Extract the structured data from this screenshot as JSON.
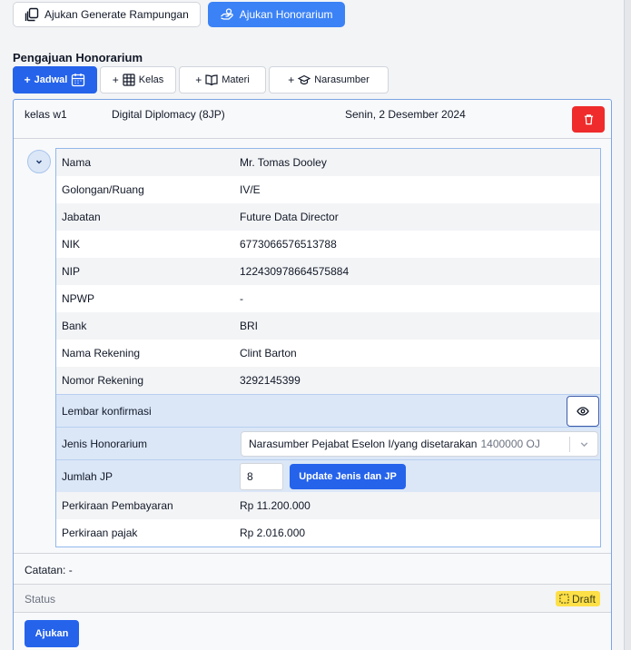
{
  "top_actions": {
    "generate_label": "Ajukan Generate Rampungan",
    "honorarium_label": "Ajukan Honorarium"
  },
  "section_title": "Pengajuan Honorarium",
  "add_buttons": {
    "jadwal": "Jadwal",
    "kelas": "Kelas",
    "materi": "Materi",
    "narasumber": "Narasumber",
    "plus": "+"
  },
  "card": {
    "kelas": "kelas w1",
    "materi": "Digital Diplomacy  (8JP)",
    "tanggal": "Senin, 2 Desember 2024"
  },
  "details": [
    {
      "label": "Nama",
      "value": "Mr. Tomas Dooley"
    },
    {
      "label": "Golongan/Ruang",
      "value": "IV/E"
    },
    {
      "label": "Jabatan",
      "value": "Future Data Director"
    },
    {
      "label": "NIK",
      "value": "6773066576513788"
    },
    {
      "label": "NIP",
      "value": "122430978664575884"
    },
    {
      "label": "NPWP",
      "value": "-"
    },
    {
      "label": "Bank",
      "value": "BRI"
    },
    {
      "label": "Nama Rekening",
      "value": "Clint Barton"
    },
    {
      "label": "Nomor Rekening",
      "value": "3292145399"
    }
  ],
  "lembar_konfirmasi": "Lembar konfirmasi",
  "jenis_honorarium": {
    "label": "Jenis Honorarium",
    "selected": "Narasumber Pejabat Eselon I/yang disetarakan",
    "amount": "1400000 OJ"
  },
  "jumlah_jp": {
    "label": "Jumlah JP",
    "value": "8",
    "update_label": "Update Jenis dan JP"
  },
  "perkiraan_pembayaran": {
    "label": "Perkiraan Pembayaran",
    "value": "Rp 11.200.000"
  },
  "perkiraan_pajak": {
    "label": "Perkiraan pajak",
    "value": "Rp 2.016.000"
  },
  "catatan": "Catatan: -",
  "status": {
    "label": "Status",
    "badge": "Draft"
  },
  "submit_label": "Ajukan",
  "colors": {
    "primary": "#2563eb",
    "danger": "#ef2b2b",
    "draft": "#fde047",
    "highlight": "#dbe7f7"
  }
}
